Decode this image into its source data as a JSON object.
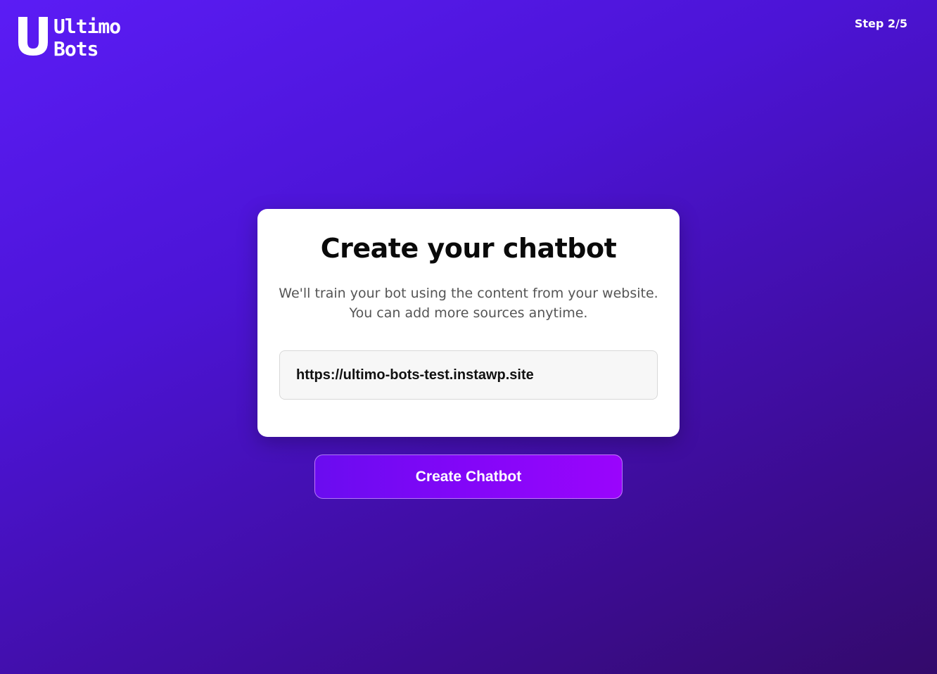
{
  "brand": {
    "logo_icon": "ultimo-bots-u-logo",
    "line1": "Ultimo",
    "line2": "Bots"
  },
  "progress": {
    "label": "Step 2/5"
  },
  "card": {
    "title": "Create your chatbot",
    "subtitle_line1": "We'll train your bot using the content from your website.",
    "subtitle_line2": "You can add more sources anytime."
  },
  "url_input": {
    "value": "https://ultimo-bots-test.instawp.site"
  },
  "actions": {
    "create_label": "Create Chatbot"
  },
  "colors": {
    "background_start": "#5b1cf5",
    "background_end": "#330a6b",
    "button_start": "#6a0cf0",
    "button_end": "#9a05fc"
  }
}
